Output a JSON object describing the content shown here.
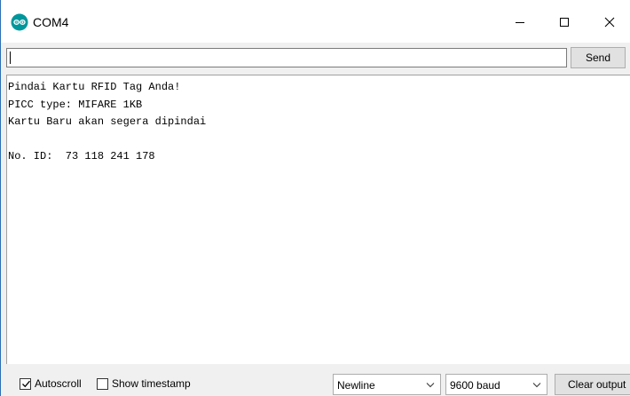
{
  "window": {
    "title": "COM4"
  },
  "input": {
    "value": "",
    "send_label": "Send"
  },
  "output": {
    "lines": [
      "Pindai Kartu RFID Tag Anda!",
      "PICC type: MIFARE 1KB",
      "Kartu Baru akan segera dipindai",
      "",
      "No. ID:  73 118 241 178"
    ]
  },
  "footer": {
    "autoscroll": {
      "label": "Autoscroll",
      "checked": true
    },
    "timestamp": {
      "label": "Show timestamp",
      "checked": false
    },
    "line_ending": "Newline",
    "baud_rate": "9600 baud",
    "clear_label": "Clear output"
  },
  "colors": {
    "app_icon": "#00979c",
    "window_border": "#2a6fb5"
  }
}
